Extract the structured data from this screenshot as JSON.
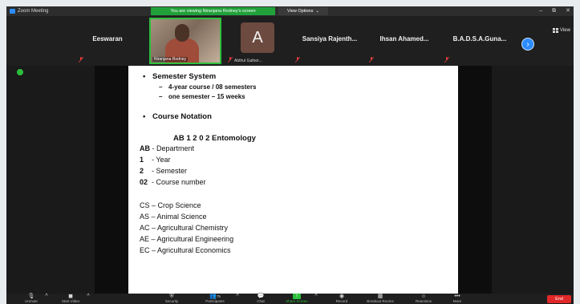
{
  "window": {
    "title": "Zoom Meeting",
    "share_banner": "You are viewing Niranjana Rodney's screen",
    "view_options": "View Options",
    "view_options_caret": "⌄",
    "controls": [
      "–",
      "⧉",
      "✕"
    ]
  },
  "participants": [
    {
      "name": "Eeswaran",
      "type": "name"
    },
    {
      "name": "Niranjana Rodney",
      "type": "video"
    },
    {
      "name": "Abthul Gafoor...",
      "type": "avatar",
      "initial": "A"
    },
    {
      "name": "Sansiya Rajenth...",
      "type": "name"
    },
    {
      "name": "Ihsan Ahamed...",
      "type": "name"
    },
    {
      "name": "B.A.D.S.A.Guna...",
      "type": "name"
    }
  ],
  "next_arrow": "›",
  "view_button": "View",
  "slide": {
    "bullet": "•",
    "dash": "–",
    "semester_system": "Semester System",
    "semester_sub1": "4-year course / 08 semesters",
    "semester_sub2": "one semester – 15 weeks",
    "course_notation": "Course Notation",
    "code_title": "AB 1 2 0 2  Entomology",
    "lines": [
      {
        "code": "AB",
        "text": " - Department"
      },
      {
        "code": "1",
        "text": "    - Year"
      },
      {
        "code": "2",
        "text": "    - Semester"
      },
      {
        "code": "02",
        "text": "  - Course number"
      },
      {
        "code": "",
        "text": "CS – Crop Science"
      },
      {
        "code": "",
        "text": "AS – Animal Science"
      },
      {
        "code": "",
        "text": "AC – Agricultural Chemistry"
      },
      {
        "code": "",
        "text": "AE – Agricultural Engineering"
      },
      {
        "code": "",
        "text": "EC – Agricultural Economics"
      }
    ]
  },
  "toolbar": {
    "unmute": "Unmute",
    "start_video": "Start Video",
    "security": "Security",
    "participants": "Participants",
    "participants_count": "75",
    "chat": "Chat",
    "share_screen": "Share Screen",
    "record": "Record",
    "breakout_rooms": "Breakout Rooms",
    "reactions": "Reactions",
    "more": "More",
    "end": "End",
    "caret": "^"
  },
  "colors": {
    "share_green": "#21a13a",
    "zoom_blue": "#2d8cff",
    "end_red": "#e02828"
  }
}
